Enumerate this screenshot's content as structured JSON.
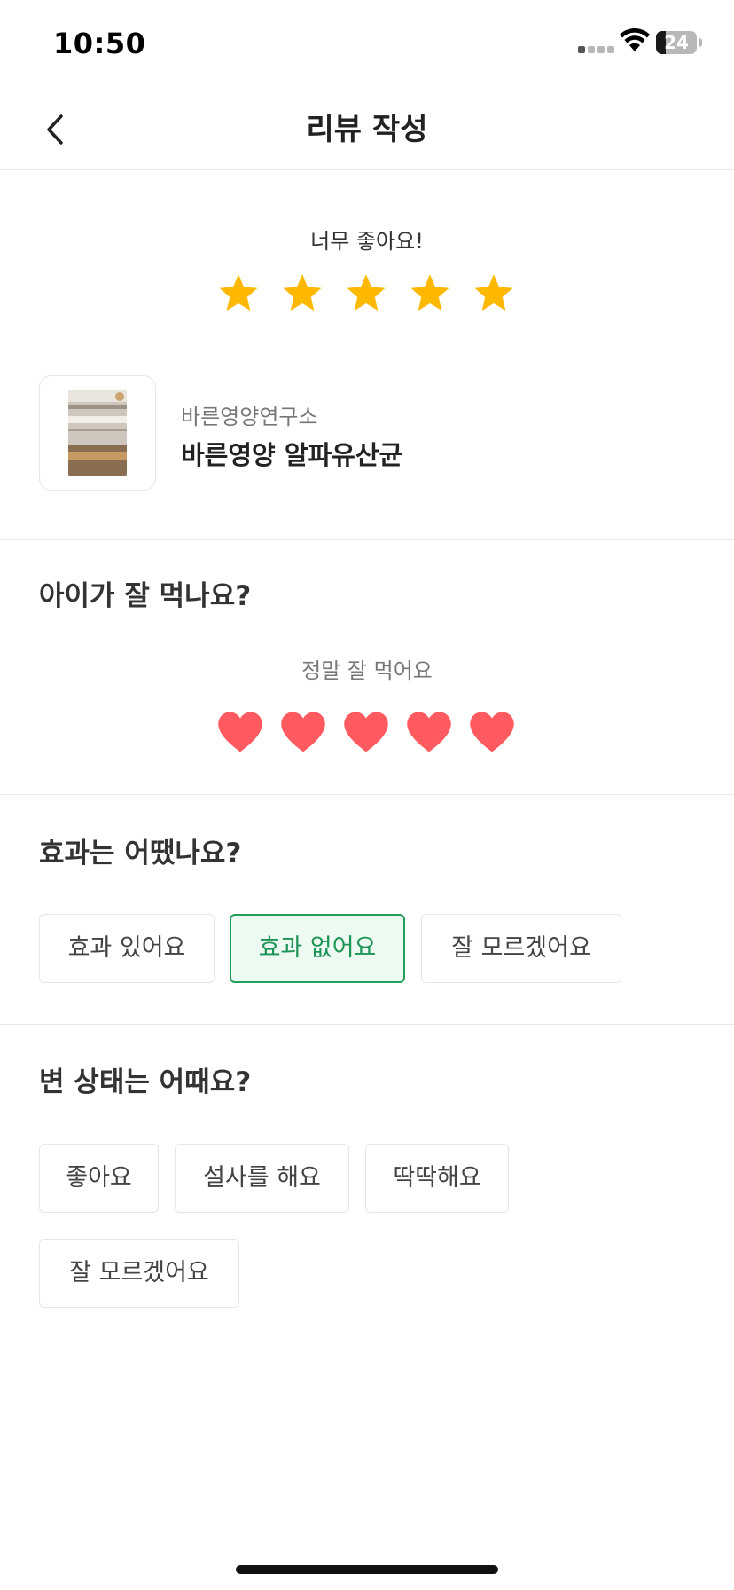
{
  "status_bar": {
    "time": "10:50",
    "battery_level": "24",
    "battery_fraction": 0.24,
    "icons": [
      "signal-icon",
      "wifi-icon",
      "battery-icon"
    ]
  },
  "header": {
    "title": "리뷰 작성",
    "back_icon": "chevron-left-icon"
  },
  "rating": {
    "caption": "너무 좋아요!",
    "value": 5,
    "max": 5,
    "star_color": "#FFB800"
  },
  "product": {
    "brand": "바른영양연구소",
    "name": "바른영양 알파유산균"
  },
  "eating": {
    "title": "아이가 잘 먹나요?",
    "caption": "정말 잘 먹어요",
    "value": 5,
    "max": 5,
    "heart_color": "#FF5A5F"
  },
  "effect": {
    "title": "효과는 어땠나요?",
    "options": [
      "효과 있어요",
      "효과 없어요",
      "잘 모르겠어요"
    ],
    "selected": "효과 없어요",
    "accent_color": "#1F9F5B"
  },
  "stool": {
    "title": "변 상태는 어때요?",
    "options": [
      "좋아요",
      "설사를 해요",
      "딱딱해요",
      "잘 모르겠어요"
    ],
    "selected": null
  }
}
